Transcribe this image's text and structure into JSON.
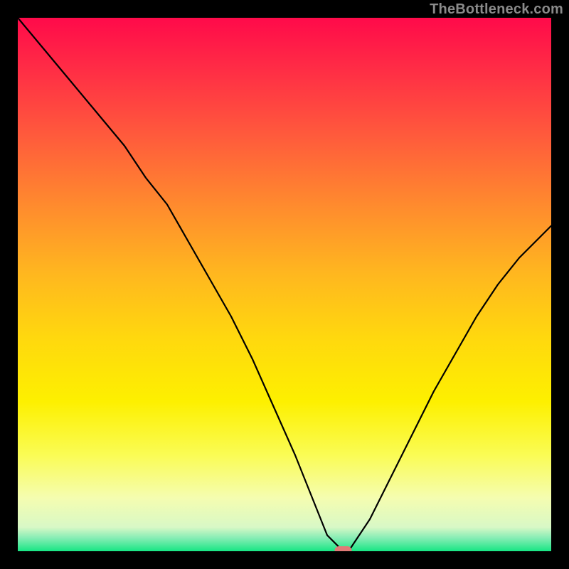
{
  "watermark": "TheBottleneck.com",
  "chart_data": {
    "type": "line",
    "title": "",
    "xlabel": "",
    "ylabel": "",
    "xlim": [
      0,
      100
    ],
    "ylim": [
      0,
      100
    ],
    "grid": false,
    "legend": false,
    "background": {
      "type": "vertical-gradient",
      "stops": [
        {
          "pos": 0.0,
          "color": "#ff0a4a"
        },
        {
          "pos": 0.1,
          "color": "#ff2e45"
        },
        {
          "pos": 0.22,
          "color": "#ff5a3c"
        },
        {
          "pos": 0.35,
          "color": "#ff8a2e"
        },
        {
          "pos": 0.48,
          "color": "#ffb71f"
        },
        {
          "pos": 0.6,
          "color": "#ffd80e"
        },
        {
          "pos": 0.72,
          "color": "#fdf000"
        },
        {
          "pos": 0.82,
          "color": "#fafc55"
        },
        {
          "pos": 0.9,
          "color": "#f5fdb0"
        },
        {
          "pos": 0.955,
          "color": "#d8f8c6"
        },
        {
          "pos": 0.975,
          "color": "#87edb5"
        },
        {
          "pos": 1.0,
          "color": "#17e684"
        }
      ]
    },
    "series": [
      {
        "name": "bottleneck-curve",
        "x": [
          0,
          5,
          10,
          15,
          20,
          24,
          28,
          32,
          36,
          40,
          44,
          48,
          52,
          56,
          58,
          60,
          61,
          62,
          66,
          70,
          74,
          78,
          82,
          86,
          90,
          94,
          98,
          100
        ],
        "y": [
          100,
          94,
          88,
          82,
          76,
          70,
          65,
          58,
          51,
          44,
          36,
          27,
          18,
          8,
          3,
          1,
          0,
          0,
          6,
          14,
          22,
          30,
          37,
          44,
          50,
          55,
          59,
          61
        ]
      }
    ],
    "marker": {
      "name": "optimal-point",
      "x": 61,
      "y": 0,
      "color": "#e07a77",
      "shape": "pill"
    }
  }
}
